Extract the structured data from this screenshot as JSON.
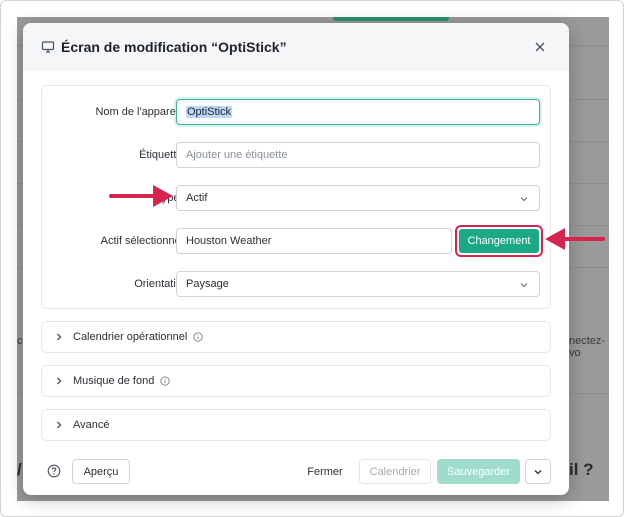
{
  "modal": {
    "title": "Écran de modification  “OptiStick”",
    "fields": {
      "device_name": {
        "label": "Nom de l'appareil",
        "required_mark": "*",
        "value": "OptiStick"
      },
      "tags": {
        "label": "Étiquettes",
        "placeholder": "Ajouter une étiquette"
      },
      "type": {
        "label": "Type c",
        "value": "Actif"
      },
      "selected_asset": {
        "label": "Actif sélectionné",
        "required_mark": "*",
        "value": "Houston Weather",
        "button": "Changement"
      },
      "orientation": {
        "label": "Orientation",
        "value": "Paysage"
      }
    },
    "sections": [
      {
        "label": "Calendrier opérationnel",
        "has_info": true
      },
      {
        "label": "Musique de fond",
        "has_info": true
      },
      {
        "label": "Avancé",
        "has_info": false
      }
    ],
    "footer": {
      "preview": "Aperçu",
      "close": "Fermer",
      "calendar": "Calendrier",
      "save": "Sauvegarder"
    }
  },
  "background": {
    "left_fragment": "c",
    "right_fragment": "nectez-vo",
    "bottom_left_fragment": "/",
    "bottom_right_fragment": "il ?"
  },
  "colors": {
    "accent": "#1ba886",
    "accent_light": "#9fdccc",
    "annotation": "#d6254d",
    "required": "#e5484d"
  },
  "icons": [
    "monitor-icon",
    "close-icon",
    "chevron-down-icon",
    "chevron-right-icon",
    "info-icon",
    "help-icon",
    "arrow-annotation"
  ]
}
